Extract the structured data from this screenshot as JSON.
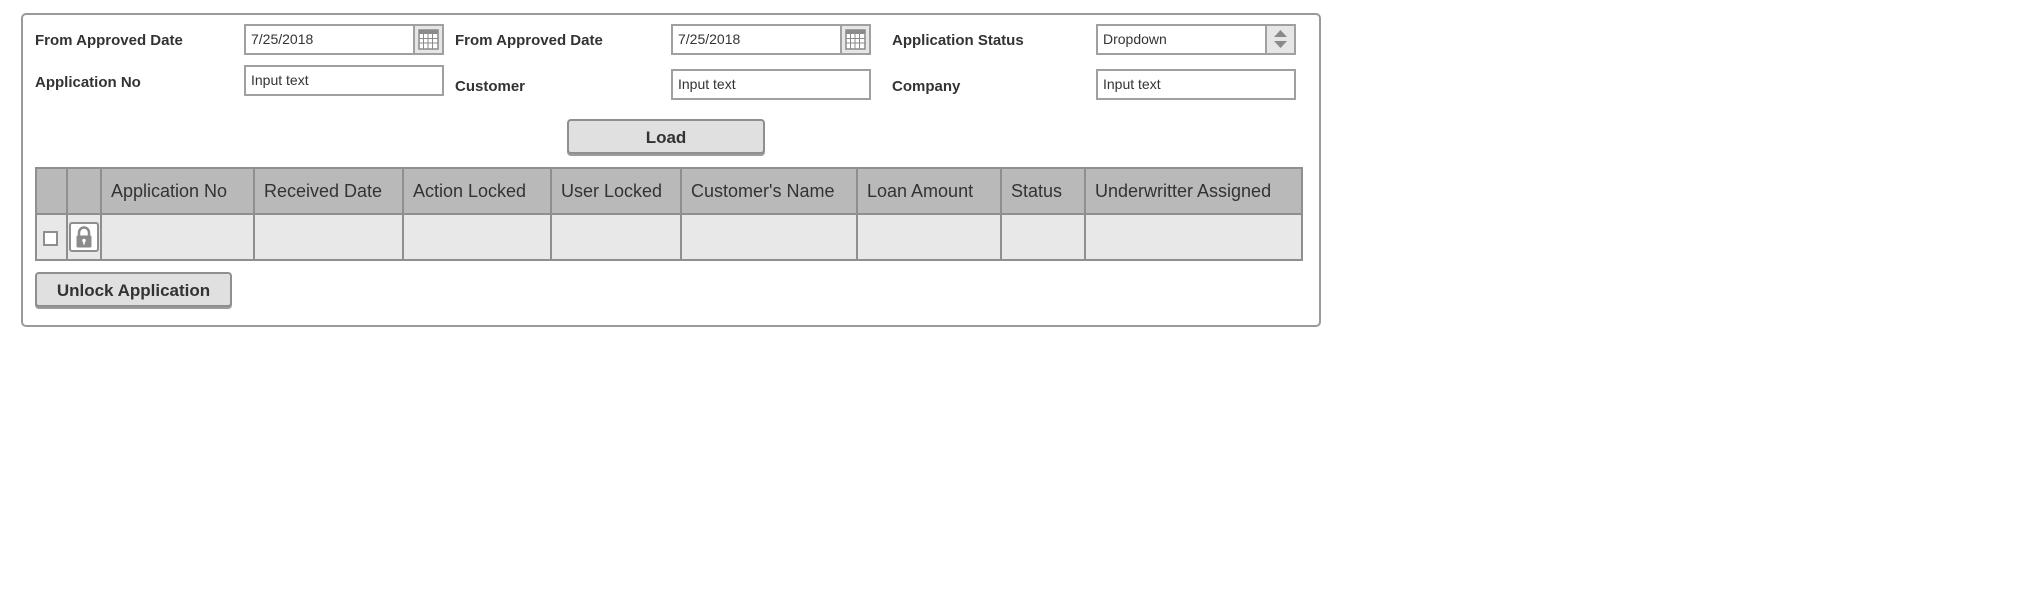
{
  "filters": {
    "from_date_1": {
      "label": "From Approved Date",
      "value": "7/25/2018"
    },
    "from_date_2": {
      "label": "From Approved Date",
      "value": "7/25/2018"
    },
    "application_status": {
      "label": "Application Status",
      "value": "Dropdown"
    },
    "application_no": {
      "label": "Application No",
      "placeholder": "Input text"
    },
    "customer": {
      "label": "Customer",
      "placeholder": "Input text"
    },
    "company": {
      "label": "Company",
      "placeholder": "Input text"
    }
  },
  "load_button": "Load",
  "table": {
    "columns": [
      "Application No",
      "Received Date",
      "Action Locked",
      "User Locked",
      "Customer's Name",
      "Loan Amount",
      "Status",
      "Underwritter Assigned"
    ],
    "rows": [
      {
        "checked": false,
        "locked": true,
        "cells": [
          "",
          "",
          "",
          "",
          "",
          "",
          "",
          ""
        ]
      }
    ]
  },
  "unlock_button": "Unlock Application",
  "icons": {
    "date_picker": "calendar-icon",
    "dropdown": "updown-arrows-icon",
    "row_lock": "lock-icon"
  },
  "colors": {
    "header_bg": "#b9b9b9",
    "cell_bg": "#e8e8e8",
    "border": "#8f8f8f",
    "button_bg": "#e0e0e0"
  }
}
